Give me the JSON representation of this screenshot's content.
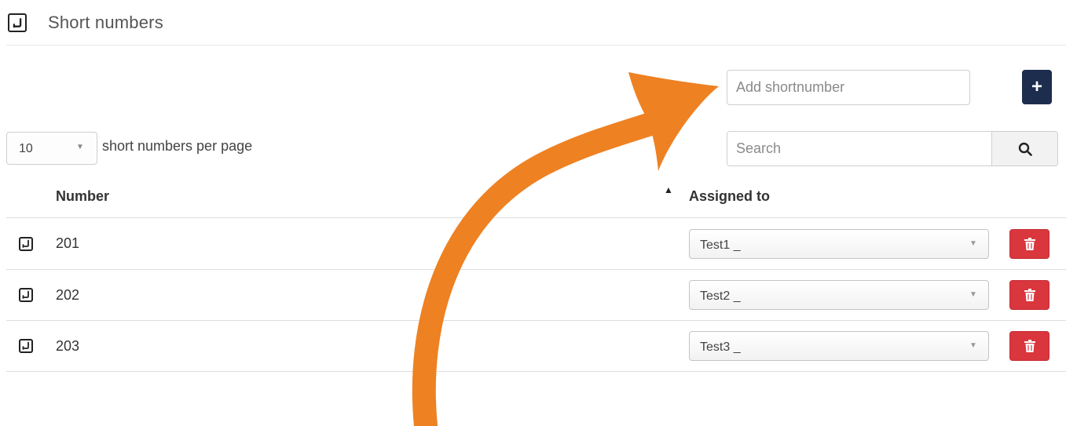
{
  "header": {
    "title": "Short numbers",
    "icon": "phone-icon"
  },
  "add_shortnumber": {
    "placeholder": "Add shortnumber",
    "button_label": "+"
  },
  "pagination": {
    "per_page_value": "10",
    "per_page_label": "short numbers per page"
  },
  "search": {
    "placeholder": "Search"
  },
  "table": {
    "columns": [
      "Number",
      "Assigned to"
    ],
    "sort_indicator": "▲",
    "rows": [
      {
        "number": "201",
        "assigned_to": "Test1 _"
      },
      {
        "number": "202",
        "assigned_to": "Test2 _"
      },
      {
        "number": "203",
        "assigned_to": "Test3 _"
      }
    ]
  },
  "colors": {
    "add_button": "#1d2d4e",
    "delete_button": "#d9363e",
    "annotation_arrow": "#ee8122"
  }
}
